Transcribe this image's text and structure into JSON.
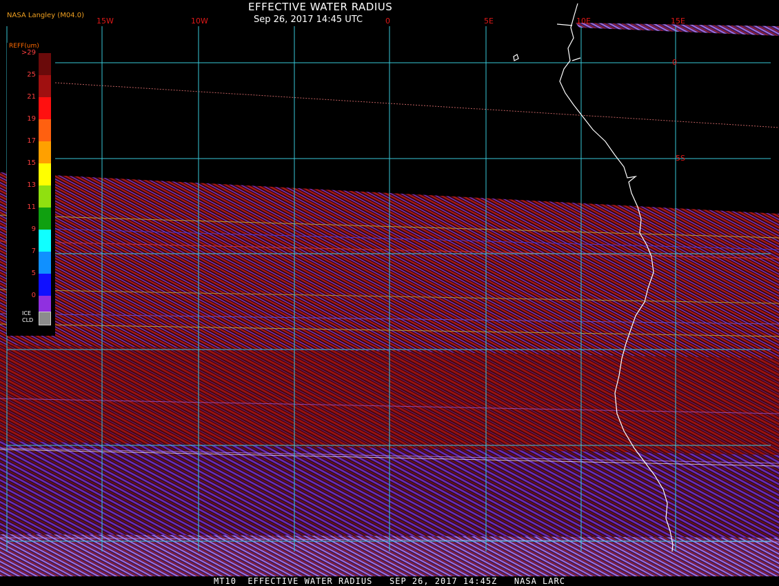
{
  "header": {
    "title": "EFFECTIVE WATER RADIUS",
    "subtitle": "Sep 26, 2017 14:45 UTC",
    "credit": "NASA Langley (M04.0)"
  },
  "footer": {
    "text": "MT10  EFFECTIVE WATER RADIUS   SEP 26, 2017 14:45Z   NASA LARC"
  },
  "grid": {
    "longitude_labels": [
      "15W",
      "10W",
      "0",
      "5E",
      "10E",
      "15E"
    ],
    "latitude_labels": [
      "0",
      "5S"
    ],
    "line_color": "#38c8d8",
    "label_color": "#e01818"
  },
  "legend": {
    "title": "REFF(um)",
    "ticks": [
      ">29",
      "25",
      "21",
      "19",
      "17",
      "15",
      "13",
      "11",
      "9",
      "7",
      "5",
      "0"
    ],
    "colors": [
      "#6a0a0a",
      "#a01010",
      "#ff1010",
      "#ff6010",
      "#ffa000",
      "#ffff00",
      "#90e010",
      "#10a010",
      "#10ffff",
      "#1090ff",
      "#1010ff",
      "#9030e0"
    ],
    "ice_label": "ICE CLD",
    "ice_color": "#8c8c8c"
  },
  "colors": {
    "coastline": "#ffffff",
    "cloud_dark_red": "#8b0a0a",
    "cloud_purple": "#7a30c8"
  }
}
